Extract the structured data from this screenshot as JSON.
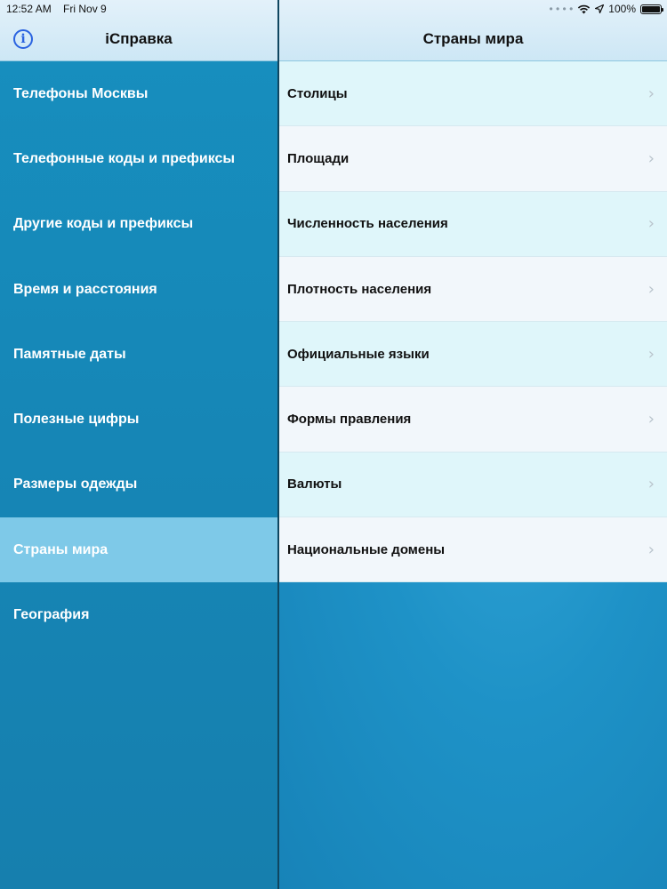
{
  "status_bar": {
    "time": "12:52 AM",
    "date": "Fri Nov 9",
    "battery": "100%",
    "battery_level": 1.0,
    "icons": [
      "wifi-icon",
      "location-arrow-icon",
      "battery-icon"
    ]
  },
  "sidebar": {
    "title": "iСправка",
    "info_icon": "info-icon",
    "selected_index": 7,
    "items": [
      {
        "label": "Телефоны Москвы"
      },
      {
        "label": "Телефонные коды и префиксы"
      },
      {
        "label": "Другие коды и префиксы"
      },
      {
        "label": "Время и расстояния"
      },
      {
        "label": "Памятные даты"
      },
      {
        "label": "Полезные цифры"
      },
      {
        "label": "Размеры одежды"
      },
      {
        "label": "Страны мира"
      },
      {
        "label": "География"
      }
    ]
  },
  "detail": {
    "title": "Страны мира",
    "rows": [
      {
        "label": "Столицы"
      },
      {
        "label": "Площади"
      },
      {
        "label": "Численность населения"
      },
      {
        "label": "Плотность населения"
      },
      {
        "label": "Официальные языки"
      },
      {
        "label": "Формы правления"
      },
      {
        "label": "Валюты"
      },
      {
        "label": "Национальные домены"
      }
    ]
  },
  "colors": {
    "sidebar_bg": "#1686b6",
    "sidebar_selected": "#7ec9e8",
    "header_bg": "#d8ecf8",
    "row_cyan": "#dff6fa",
    "row_white": "#f2f7fb",
    "info_blue": "#2a63e0"
  }
}
